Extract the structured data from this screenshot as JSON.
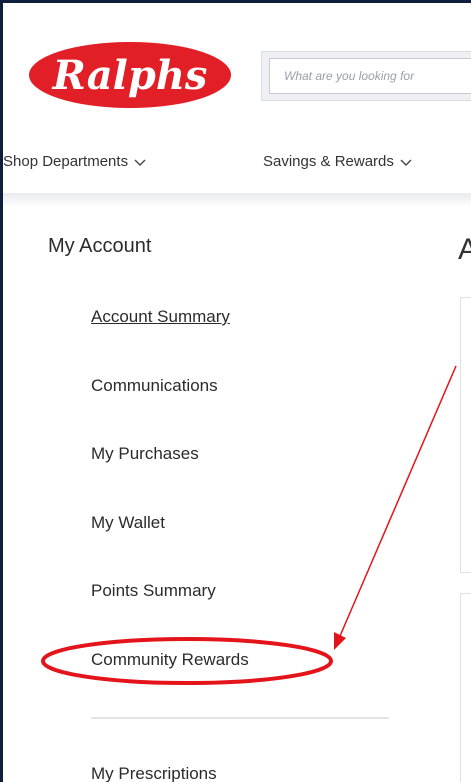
{
  "brand": {
    "logo_text": "Ralphs",
    "color": "#e21f26"
  },
  "search": {
    "placeholder": "What are you looking for"
  },
  "nav": [
    {
      "label": "Shop Departments"
    },
    {
      "label": "Savings & Rewards"
    }
  ],
  "sidebar": {
    "title": "My Account",
    "items": [
      {
        "label": "Account Summary",
        "active": true
      },
      {
        "label": "Communications"
      },
      {
        "label": "My Purchases"
      },
      {
        "label": "My Wallet"
      },
      {
        "label": "Points Summary"
      },
      {
        "label": "Community Rewards",
        "highlighted": true
      },
      {
        "label": "My Prescriptions"
      }
    ]
  },
  "main": {
    "heading_fragment": "A"
  },
  "annotation": {
    "color": "#e4141b"
  }
}
